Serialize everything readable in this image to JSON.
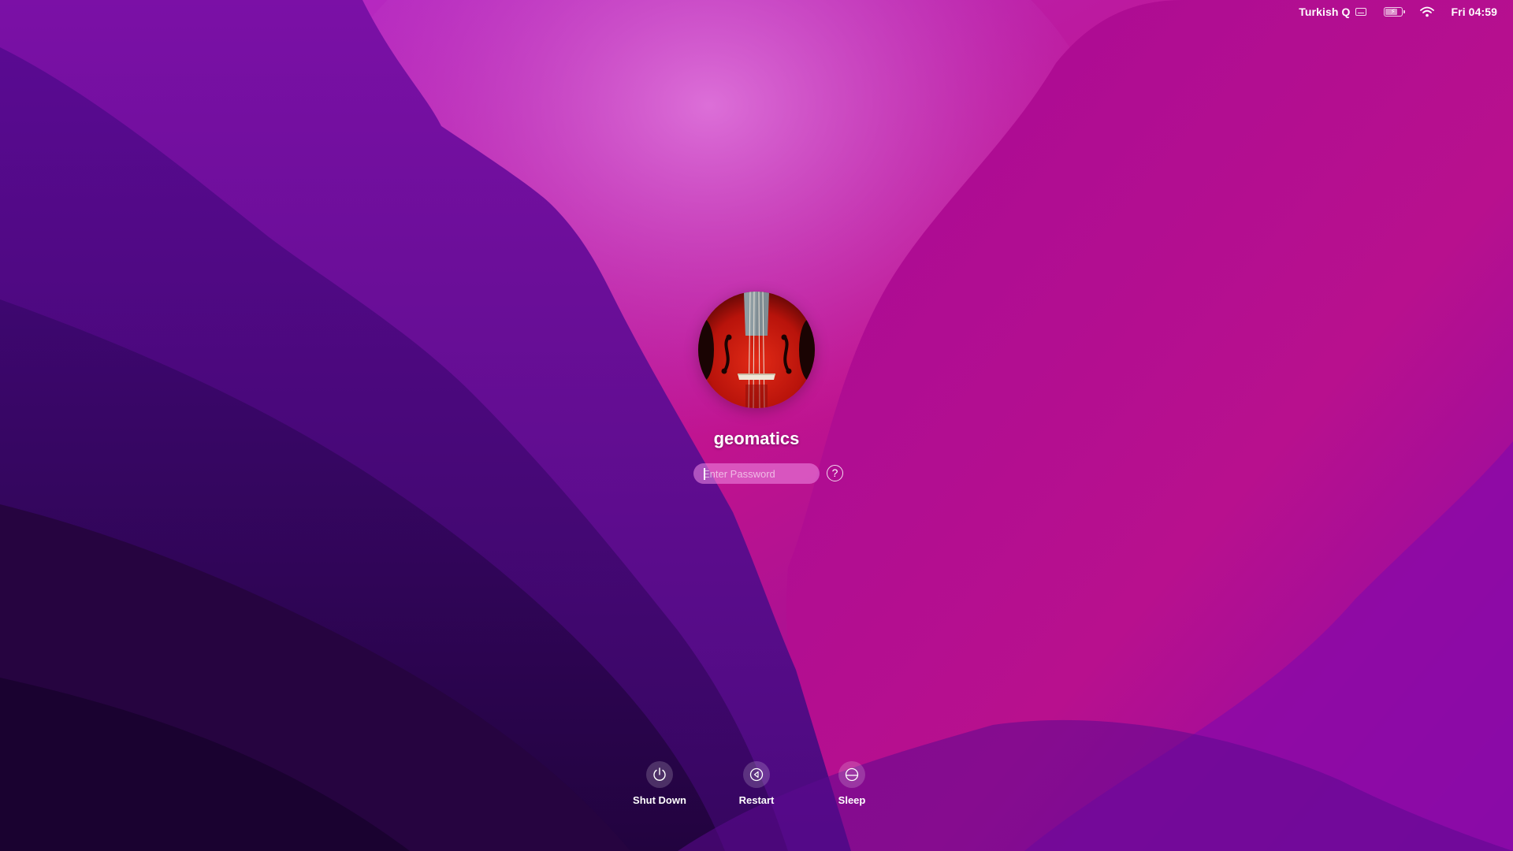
{
  "menubar": {
    "input_source": "Turkish Q",
    "clock": "Fri 04:59",
    "icons": [
      "keyboard-icon",
      "battery-charging-icon",
      "wifi-icon"
    ]
  },
  "login": {
    "username": "geomatics",
    "password_placeholder": "Enter Password",
    "password_value": "",
    "hint_label": "?",
    "avatar_image": "violin-icon"
  },
  "power": {
    "shutdown_label": "Shut Down",
    "restart_label": "Restart",
    "sleep_label": "Sleep"
  },
  "colors": {
    "wallpaper_dark": "#1c0238",
    "wallpaper_purple": "#5a0c8c",
    "wallpaper_magenta": "#b0108f",
    "wallpaper_pink": "#cc4dc6"
  }
}
